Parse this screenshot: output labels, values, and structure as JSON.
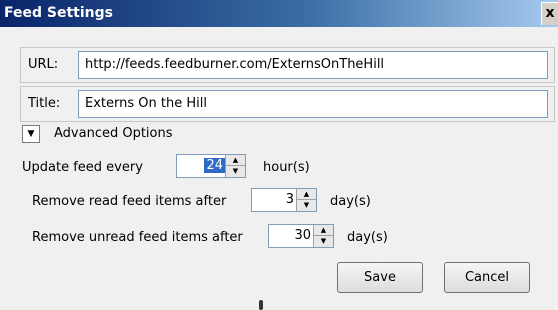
{
  "window": {
    "title": "Feed Settings",
    "close_label": "x"
  },
  "url": {
    "label": "URL:",
    "value": "http://feeds.feedburner.com/ExternsOnTheHill"
  },
  "title_field": {
    "label": "Title:",
    "value": "Externs On the Hill"
  },
  "advanced": {
    "toggle_glyph": "▼",
    "label": "Advanced Options"
  },
  "update_feed": {
    "label": "Update feed every",
    "value": "24",
    "unit": "hour(s)"
  },
  "remove_read": {
    "label": "Remove read feed items after",
    "value": "3",
    "unit": "day(s)"
  },
  "remove_unread": {
    "label": "Remove unread feed items after",
    "value": "30",
    "unit": "day(s)"
  },
  "spinner_glyphs": {
    "up": "▲",
    "down": "▼"
  },
  "buttons": {
    "save": "Save",
    "cancel": "Cancel"
  }
}
